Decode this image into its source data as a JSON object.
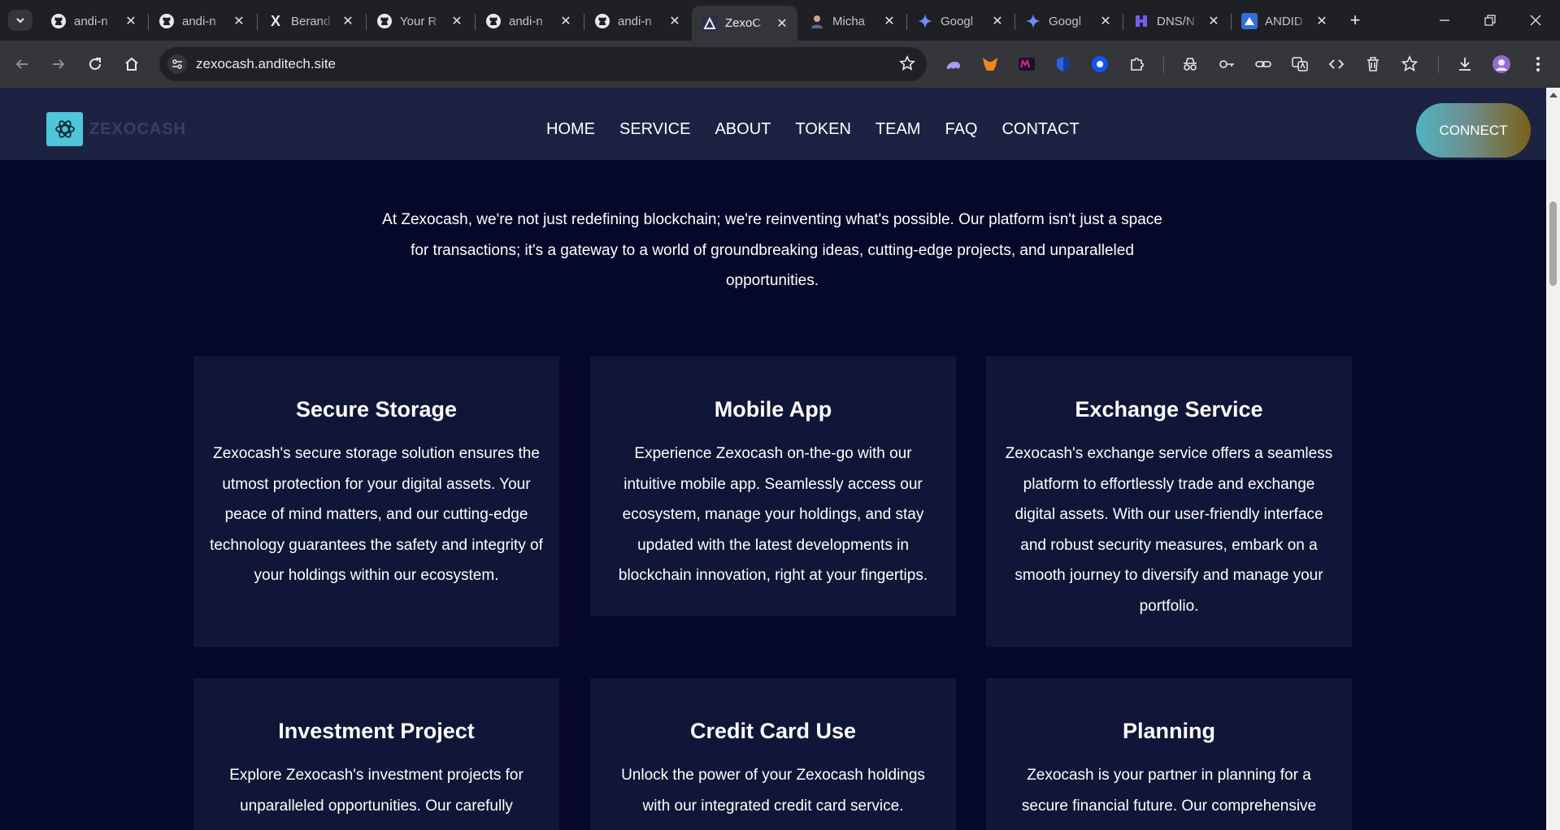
{
  "browser": {
    "tabs": [
      {
        "title": "andi-n",
        "icon": "github-icon"
      },
      {
        "title": "andi-n",
        "icon": "github-icon"
      },
      {
        "title": "Berand",
        "icon": "x-icon"
      },
      {
        "title": "Your R",
        "icon": "github-icon"
      },
      {
        "title": "andi-n",
        "icon": "github-icon"
      },
      {
        "title": "andi-n",
        "icon": "github-icon"
      },
      {
        "title": "ZexoC",
        "icon": "zexocash-icon"
      },
      {
        "title": "Micha",
        "icon": "avatar-icon"
      },
      {
        "title": "Googl",
        "icon": "gemini-icon"
      },
      {
        "title": "Googl",
        "icon": "gemini-icon"
      },
      {
        "title": "DNS/N",
        "icon": "dns-icon"
      },
      {
        "title": "ANDID",
        "icon": "andid-icon"
      }
    ],
    "active_tab": 6,
    "url": "zexocash.anditech.site"
  },
  "site": {
    "logo_text": "ZEXOCASH",
    "nav": [
      "HOME",
      "SERVICE",
      "ABOUT",
      "TOKEN",
      "TEAM",
      "FAQ",
      "CONTACT"
    ],
    "connect_label": "CONNECT",
    "intro": "At Zexocash, we're not just redefining blockchain; we're reinventing what's possible. Our platform isn't just a space for transactions; it's a gateway to a world of groundbreaking ideas, cutting-edge projects, and unparalleled opportunities.",
    "cards": [
      {
        "title": "Secure Storage",
        "text": "Zexocash's secure storage solution ensures the utmost protection for your digital assets. Your peace of mind matters, and our cutting-edge technology guarantees the safety and integrity of your holdings within our ecosystem."
      },
      {
        "title": "Mobile App",
        "text": "Experience Zexocash on-the-go with our intuitive mobile app. Seamlessly access our ecosystem, manage your holdings, and stay updated with the latest developments in blockchain innovation, right at your fingertips."
      },
      {
        "title": "Exchange Service",
        "text": "Zexocash's exchange service offers a seamless platform to effortlessly trade and exchange digital assets. With our user-friendly interface and robust security measures, embark on a smooth journey to diversify and manage your portfolio."
      },
      {
        "title": "Investment Project",
        "text": "Explore Zexocash's investment projects for unparalleled opportunities. Our carefully"
      },
      {
        "title": "Credit Card Use",
        "text": "Unlock the power of your Zexocash holdings with our integrated credit card service."
      },
      {
        "title": "Planning",
        "text": "Zexocash is your partner in planning for a secure financial future. Our comprehensive"
      }
    ]
  }
}
